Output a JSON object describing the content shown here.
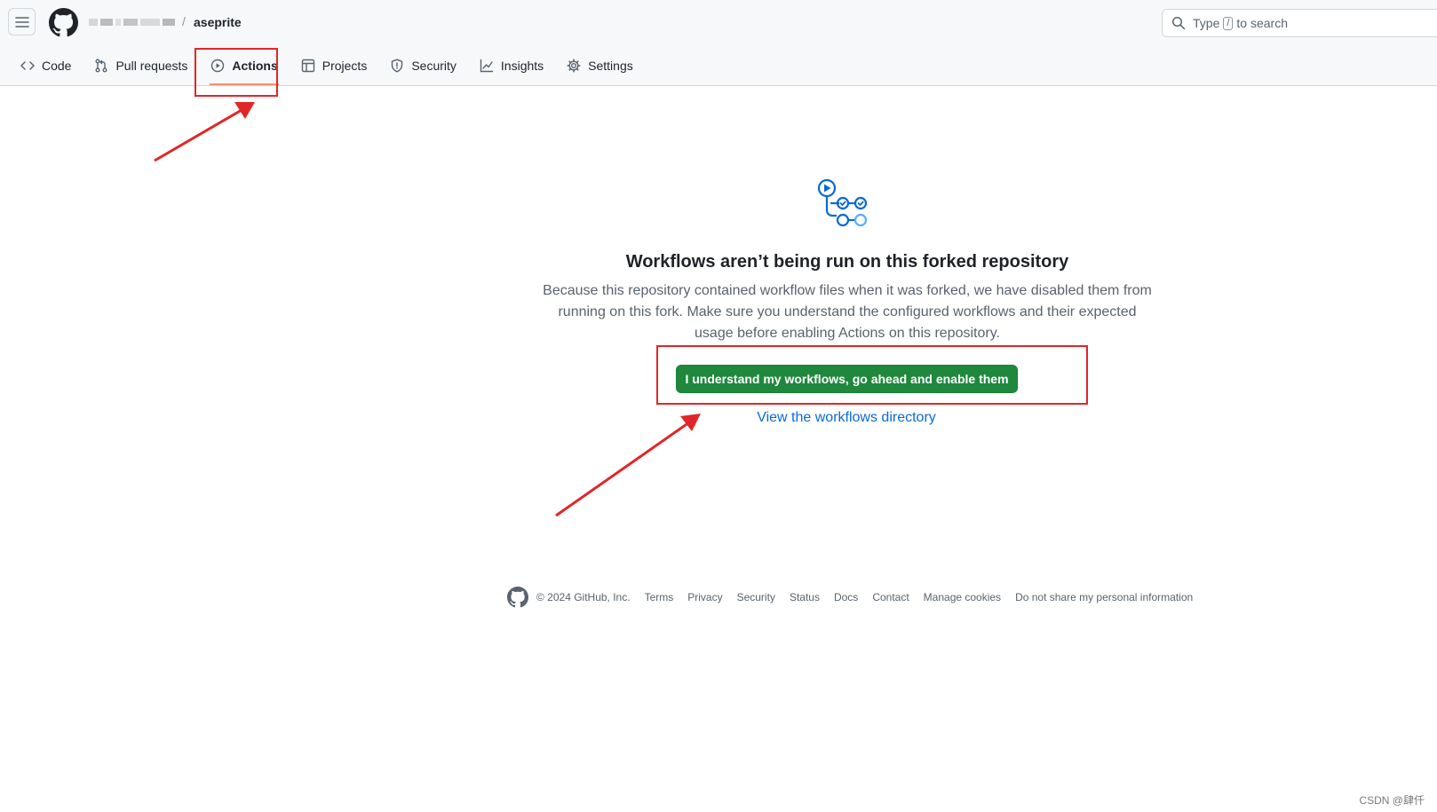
{
  "header": {
    "repo_name": "aseprite",
    "slash": "/",
    "search_prefix": "Type",
    "search_key": "/",
    "search_suffix": "to search"
  },
  "tabs": [
    {
      "label": "Code",
      "icon": "code-icon"
    },
    {
      "label": "Pull requests",
      "icon": "git-pull-request-icon"
    },
    {
      "label": "Actions",
      "icon": "play-icon",
      "active": true
    },
    {
      "label": "Projects",
      "icon": "table-icon"
    },
    {
      "label": "Security",
      "icon": "shield-icon"
    },
    {
      "label": "Insights",
      "icon": "graph-icon"
    },
    {
      "label": "Settings",
      "icon": "gear-icon"
    }
  ],
  "main": {
    "title": "Workflows aren’t being run on this forked repository",
    "description": "Because this repository contained workflow files when it was forked, we have disabled them from running on this fork. Make sure you understand the configured workflows and their expected usage before enabling Actions on this repository.",
    "enable_button": "I understand my workflows, go ahead and enable them",
    "directory_link": "View the workflows directory"
  },
  "footer": {
    "copyright": "© 2024 GitHub, Inc.",
    "links": [
      "Terms",
      "Privacy",
      "Security",
      "Status",
      "Docs",
      "Contact",
      "Manage cookies",
      "Do not share my personal information"
    ]
  },
  "watermark": "CSDN @肆仟",
  "colors": {
    "primary_button": "#1f883d",
    "link": "#0969da",
    "annotation": "#e12628",
    "active_tab_underline": "#fd8c73"
  }
}
